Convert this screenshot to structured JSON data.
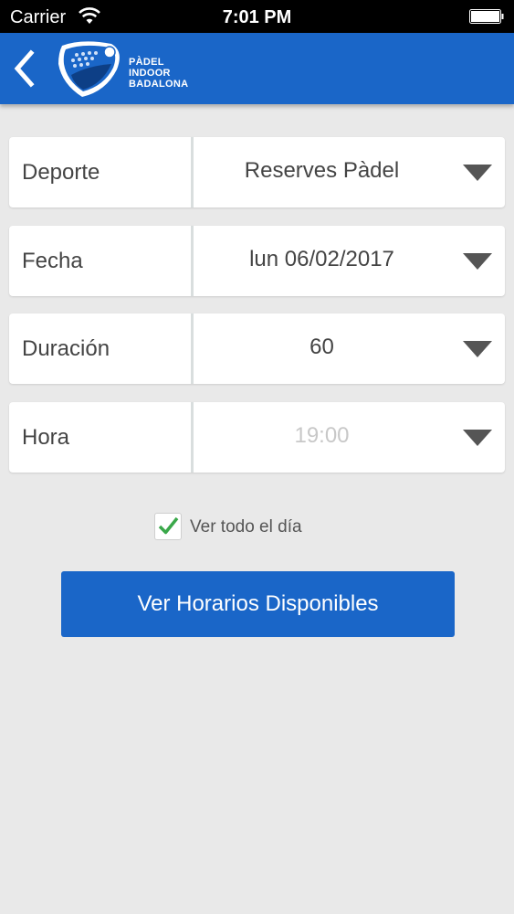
{
  "status_bar": {
    "carrier": "Carrier",
    "time": "7:01 PM",
    "wifi_icon": "wifi-icon",
    "battery_icon": "battery-icon"
  },
  "header": {
    "back_icon": "chevron-left-icon",
    "logo_lines": [
      "PÀDEL",
      "INDOOR",
      "BADALONA"
    ],
    "background_color": "#1a66c8"
  },
  "form": {
    "fields": [
      {
        "label": "Deporte",
        "value": "Reserves Pàdel"
      },
      {
        "label": "Fecha",
        "value": "lun 06/02/2017"
      },
      {
        "label": "Duración",
        "value": "60"
      },
      {
        "label": "Hora",
        "value": "19:00"
      }
    ],
    "dropdown_icon": "triangle-down-icon"
  },
  "checkbox": {
    "label": "Ver todo el día",
    "checked": true,
    "check_color": "#3aa84a"
  },
  "button": {
    "label": "Ver Horarios Disponibles",
    "color": "#1a66c8"
  }
}
